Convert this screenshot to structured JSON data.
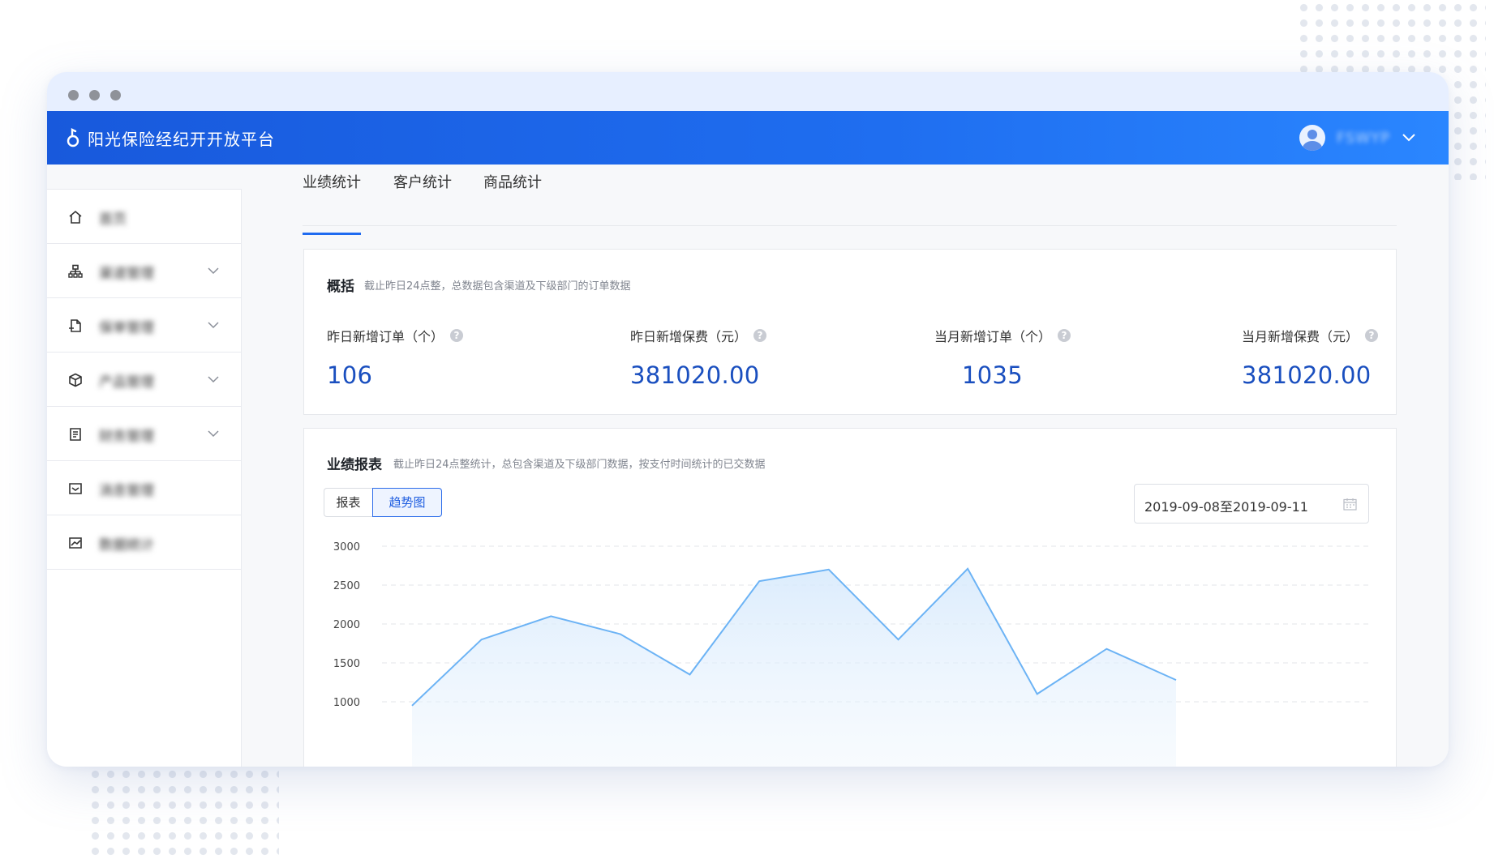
{
  "app": {
    "brand_title": "阳光保险经纪开开放平台",
    "user_name": "FSWYP"
  },
  "sidebar": {
    "items": [
      {
        "label": "首页",
        "icon": "home-icon",
        "expandable": false
      },
      {
        "label": "渠道管理",
        "icon": "org-chart-icon",
        "expandable": true
      },
      {
        "label": "保单管理",
        "icon": "document-icon",
        "expandable": true
      },
      {
        "label": "产品管理",
        "icon": "cube-icon",
        "expandable": true
      },
      {
        "label": "财务管理",
        "icon": "file-list-icon",
        "expandable": true
      },
      {
        "label": "消息管理",
        "icon": "message-icon",
        "expandable": false
      },
      {
        "label": "数据统计",
        "icon": "trend-chart-icon",
        "expandable": false
      }
    ]
  },
  "tabs": [
    {
      "label": "业绩统计",
      "active": true
    },
    {
      "label": "客户统计",
      "active": false
    },
    {
      "label": "商品统计",
      "active": false
    }
  ],
  "overview": {
    "title": "概括",
    "subtitle": "截止昨日24点整，总数据包含渠道及下级部门的订单数据",
    "stats": [
      {
        "label": "昨日新增订单（个）",
        "value": "106"
      },
      {
        "label": "昨日新增保费（元）",
        "value": "381020.00"
      },
      {
        "label": "当月新增订单（个）",
        "value": "1035"
      },
      {
        "label": "当月新增保费（元）",
        "value": "381020.00"
      }
    ],
    "help_glyph": "?"
  },
  "report": {
    "title": "业绩报表",
    "subtitle": "截止昨日24点整统计，总包含渠道及下级部门数据，按支付时间统计的已交数据",
    "view_table_label": "报表",
    "view_trend_label": "趋势图",
    "date_range": "2019-09-08至2019-09-11"
  },
  "colors": {
    "accent": "#1f6bf0",
    "value_blue": "#1a4fbf",
    "line": "#6cb3f5"
  },
  "chart_data": {
    "type": "area",
    "y_ticks": [
      3000,
      2500,
      2000,
      1500,
      1000
    ],
    "ylim": [
      1000,
      3000
    ],
    "grid": true,
    "series": [
      {
        "values": [
          950,
          1800,
          2100,
          1870,
          1350,
          2550,
          2700,
          1800,
          2710,
          1100,
          1680,
          1280
        ]
      }
    ]
  }
}
